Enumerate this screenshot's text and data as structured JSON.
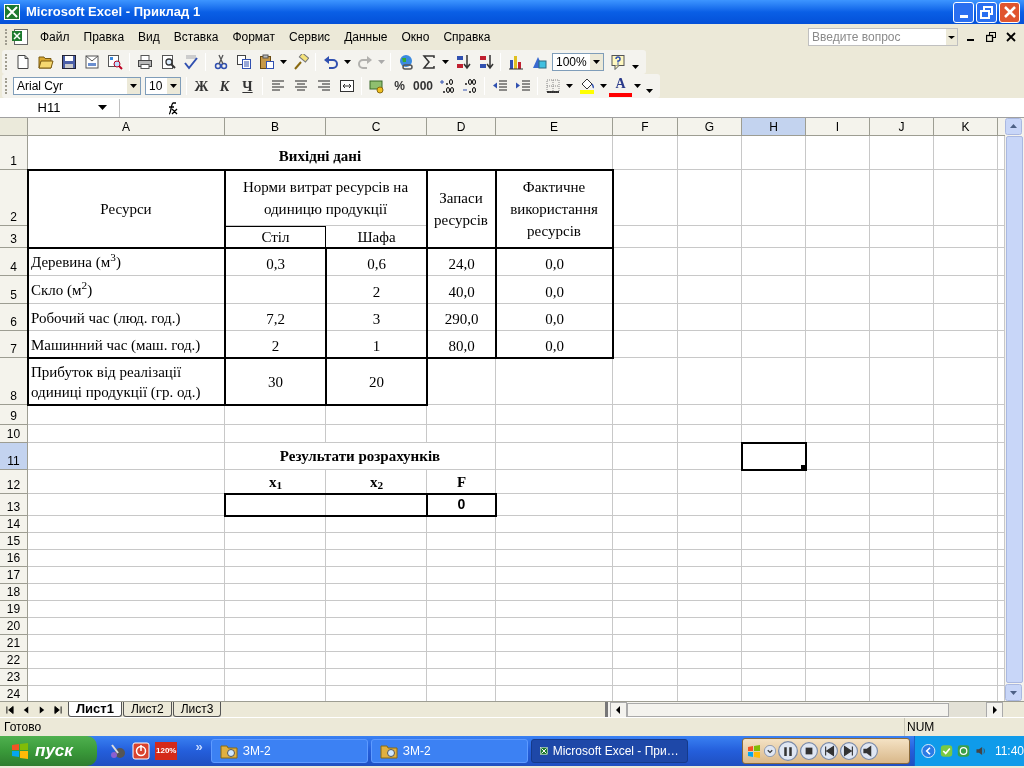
{
  "window": {
    "title": "Microsoft Excel - Приклад 1"
  },
  "menu": [
    "Файл",
    "Правка",
    "Вид",
    "Вставка",
    "Формат",
    "Сервис",
    "Данные",
    "Окно",
    "Справка"
  ],
  "question_box": {
    "placeholder": "Введите вопрос"
  },
  "standard_toolbar": [
    {
      "kind": "new",
      "disabled": false
    },
    {
      "kind": "open",
      "disabled": false
    },
    {
      "kind": "save",
      "disabled": false
    },
    {
      "kind": "permission",
      "disabled": false
    },
    {
      "kind": "research",
      "disabled": false
    },
    {
      "kind": "sep"
    },
    {
      "kind": "print",
      "disabled": false
    },
    {
      "kind": "preview",
      "disabled": false
    },
    {
      "kind": "spelling",
      "disabled": false
    },
    {
      "kind": "sep"
    },
    {
      "kind": "cut",
      "disabled": false
    },
    {
      "kind": "copy",
      "disabled": false
    },
    {
      "kind": "paste",
      "disabled": false
    },
    {
      "kind": "caret",
      "disabled": false
    },
    {
      "kind": "painter",
      "disabled": false
    },
    {
      "kind": "sep"
    },
    {
      "kind": "undo",
      "disabled": false
    },
    {
      "kind": "caret",
      "disabled": false
    },
    {
      "kind": "redo",
      "disabled": true
    },
    {
      "kind": "caret",
      "disabled": true
    },
    {
      "kind": "sep"
    },
    {
      "kind": "hyperlink",
      "disabled": false
    },
    {
      "kind": "sum",
      "disabled": false
    },
    {
      "kind": "caret",
      "disabled": false
    },
    {
      "kind": "sort-asc",
      "disabled": false
    },
    {
      "kind": "sort-desc",
      "disabled": false
    },
    {
      "kind": "sep"
    },
    {
      "kind": "chart",
      "disabled": false
    },
    {
      "kind": "drawing",
      "disabled": false
    },
    {
      "kind": "zoom-field",
      "value": "100%"
    },
    {
      "kind": "help",
      "disabled": false
    },
    {
      "kind": "options",
      "disabled": false
    }
  ],
  "formatting_toolbar": [
    {
      "kind": "font-field",
      "value": "Arial Cyr"
    },
    {
      "kind": "size-field",
      "value": "10"
    },
    {
      "kind": "sep"
    },
    {
      "kind": "bold",
      "label": "Ж"
    },
    {
      "kind": "italic",
      "label": "К"
    },
    {
      "kind": "underline",
      "label": "Ч"
    },
    {
      "kind": "sep"
    },
    {
      "kind": "align-left"
    },
    {
      "kind": "align-center"
    },
    {
      "kind": "align-right"
    },
    {
      "kind": "merge"
    },
    {
      "kind": "sep"
    },
    {
      "kind": "currency"
    },
    {
      "kind": "text",
      "label": "%"
    },
    {
      "kind": "text",
      "label": "000"
    },
    {
      "kind": "inc-decimal"
    },
    {
      "kind": "dec-decimal"
    },
    {
      "kind": "sep"
    },
    {
      "kind": "outdent"
    },
    {
      "kind": "indent"
    },
    {
      "kind": "sep"
    },
    {
      "kind": "borders"
    },
    {
      "kind": "caret"
    },
    {
      "kind": "fill-color"
    },
    {
      "kind": "caret"
    },
    {
      "kind": "font-color",
      "label": "A"
    },
    {
      "kind": "caret"
    },
    {
      "kind": "options"
    }
  ],
  "formula_bar": {
    "name_box": "H11"
  },
  "sheet": {
    "columns": [
      {
        "label": "A",
        "selected": false
      },
      {
        "label": "B",
        "selected": false
      },
      {
        "label": "C",
        "selected": false
      },
      {
        "label": "D",
        "selected": false
      },
      {
        "label": "E",
        "selected": false
      },
      {
        "label": "F",
        "selected": false
      },
      {
        "label": "G",
        "selected": false
      },
      {
        "label": "H",
        "selected": true
      },
      {
        "label": "I",
        "selected": false
      },
      {
        "label": "J",
        "selected": false
      },
      {
        "label": "K",
        "selected": false
      }
    ],
    "rows": [
      {
        "label": "1",
        "selected": false
      },
      {
        "label": "2",
        "selected": false
      },
      {
        "label": "3",
        "selected": false
      },
      {
        "label": "4",
        "selected": false
      },
      {
        "label": "5",
        "selected": false
      },
      {
        "label": "6",
        "selected": false
      },
      {
        "label": "7",
        "selected": false
      },
      {
        "label": "8",
        "selected": false
      },
      {
        "label": "9",
        "selected": false
      },
      {
        "label": "10",
        "selected": false
      },
      {
        "label": "11",
        "selected": true
      },
      {
        "label": "12",
        "selected": false
      },
      {
        "label": "13",
        "selected": false
      },
      {
        "label": "14",
        "selected": false
      },
      {
        "label": "15",
        "selected": false
      },
      {
        "label": "16",
        "selected": false
      },
      {
        "label": "17",
        "selected": false
      },
      {
        "label": "18",
        "selected": false
      },
      {
        "label": "19",
        "selected": false
      },
      {
        "label": "20",
        "selected": false
      },
      {
        "label": "21",
        "selected": false
      },
      {
        "label": "22",
        "selected": false
      },
      {
        "label": "23",
        "selected": false
      },
      {
        "label": "24",
        "selected": false
      }
    ],
    "cells": [
      {
        "kind": "title",
        "text": "Вихідні дані"
      },
      {
        "kind": "header",
        "text": "Ресурси"
      },
      {
        "kind": "header",
        "text": "Норми витрат ресурсів на одиницю продукції"
      },
      {
        "kind": "header",
        "text": "Стіл"
      },
      {
        "kind": "header",
        "text": "Шафа"
      },
      {
        "kind": "header",
        "text": "Запаси ресурсів"
      },
      {
        "kind": "header",
        "text": "Фактичне використання ресурсів"
      },
      {
        "kind": "label",
        "text": "Деревина (м$^{3}$)"
      },
      {
        "kind": "value",
        "text": "0,3"
      },
      {
        "kind": "value",
        "text": "0,6"
      },
      {
        "kind": "value",
        "text": "24,0"
      },
      {
        "kind": "value",
        "text": "0,0"
      },
      {
        "kind": "label",
        "text": "Скло (м$^{2}$)"
      },
      {
        "kind": "value",
        "text": "2"
      },
      {
        "kind": "value",
        "text": "40,0"
      },
      {
        "kind": "value",
        "text": "0,0"
      },
      {
        "kind": "label",
        "text": "Робочий час (люд. год.)"
      },
      {
        "kind": "value",
        "text": "7,2"
      },
      {
        "kind": "value",
        "text": "3"
      },
      {
        "kind": "value",
        "text": "290,0"
      },
      {
        "kind": "value",
        "text": "0,0"
      },
      {
        "kind": "label",
        "text": "Машинний час (маш. год.)"
      },
      {
        "kind": "value",
        "text": "2"
      },
      {
        "kind": "value",
        "text": "1"
      },
      {
        "kind": "value",
        "text": "80,0"
      },
      {
        "kind": "value",
        "text": "0,0"
      },
      {
        "kind": "label",
        "text": "Прибуток від реалізації одиниці продукції (гр. од.)"
      },
      {
        "kind": "header",
        "text": "30"
      },
      {
        "kind": "header",
        "text": "20"
      },
      {
        "kind": "title",
        "text": "Результати розрахунків"
      },
      {
        "kind": "var",
        "text": "x$_{1}$"
      },
      {
        "kind": "var",
        "text": "x$_{2}$"
      },
      {
        "kind": "var",
        "text": "F"
      },
      {
        "kind": "result",
        "text": "0"
      }
    ]
  },
  "sheet_tabs": [
    {
      "label": "Лист1",
      "selected": true
    },
    {
      "label": "Лист2",
      "selected": false
    },
    {
      "label": "Лист3",
      "selected": false
    }
  ],
  "status_bar": {
    "text": "Готово",
    "indicator": "NUM"
  },
  "taskbar": {
    "start": "пуск",
    "quick_launch": [
      {
        "kind": "player"
      },
      {
        "kind": "power"
      },
      {
        "kind": "zoom",
        "label": "120%"
      }
    ],
    "overflow": "»",
    "tasks": [
      {
        "kind": "folder",
        "label": "ЗМ-2",
        "selected": false
      },
      {
        "kind": "folder",
        "label": "ЗМ-2",
        "selected": false
      },
      {
        "kind": "excel",
        "label": "Microsoft Excel - При…",
        "selected": true
      }
    ],
    "clock": "11:40"
  }
}
